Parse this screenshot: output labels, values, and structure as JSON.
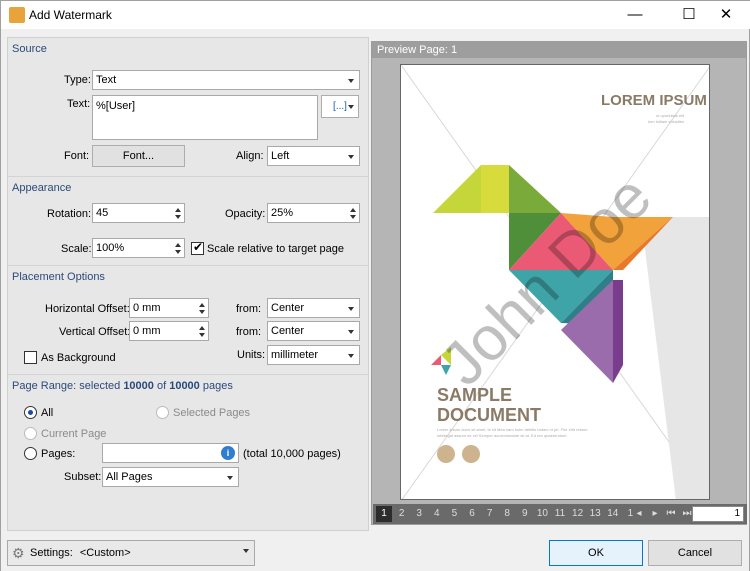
{
  "window": {
    "title": "Add Watermark",
    "minimize": "—",
    "maximize": "☐",
    "close": "✕"
  },
  "source": {
    "heading": "Source",
    "type_label": "Type:",
    "type_value": "Text",
    "text_label": "Text:",
    "text_value": "%[User]",
    "macro_button": "[...]",
    "font_label": "Font:",
    "font_button": "Font...",
    "align_label": "Align:",
    "align_value": "Left"
  },
  "appearance": {
    "heading": "Appearance",
    "rotation_label": "Rotation:",
    "rotation_value": "45",
    "opacity_label": "Opacity:",
    "opacity_value": "25%",
    "scale_label": "Scale:",
    "scale_value": "100%",
    "scale_relative_label": "Scale relative to target page",
    "scale_relative_checked": true
  },
  "placement": {
    "heading": "Placement Options",
    "h_offset_label": "Horizontal Offset:",
    "h_offset_value": "0 mm",
    "h_from_label": "from:",
    "h_from_value": "Center",
    "v_offset_label": "Vertical Offset:",
    "v_offset_value": "0 mm",
    "v_from_label": "from:",
    "v_from_value": "Center",
    "background_label": "As Background",
    "background_checked": false,
    "units_label": "Units:",
    "units_value": "millimeter"
  },
  "page_range": {
    "heading_prefix": "Page Range: selected ",
    "selected": "10000",
    "heading_mid": " of ",
    "total": "10000",
    "heading_suffix": " pages",
    "all_label": "All",
    "selected_pages_label": "Selected Pages",
    "current_page_label": "Current Page",
    "pages_label": "Pages:",
    "pages_value": "",
    "total_note": "(total 10,000 pages)",
    "subset_label": "Subset:",
    "subset_value": "All Pages"
  },
  "preview": {
    "header": "Preview Page: 1",
    "page_input": "1",
    "pages": [
      "1",
      "2",
      "3",
      "4",
      "5",
      "6",
      "7",
      "8",
      "9",
      "10",
      "11",
      "12",
      "13",
      "14",
      "1"
    ],
    "doc": {
      "lorem": "LOREM IPSUM",
      "lorem_sub1": "ut oporluitas elit",
      "lorem_sub2": "lorn tolliam volusites",
      "sample1": "SAMPLE",
      "sample2": "DOCUMENT",
      "body1": "Lorem ipsum dolor sit amet, te sit Mea nam bolm debitis habeo nt pri. Fier elitr rebum",
      "body2": "intellegat assum ne vel Semper accommodare sit at. Ed ren quaerendum",
      "watermark": "John Doe"
    }
  },
  "bottom": {
    "settings_label": "Settings:",
    "settings_value": "<Custom>",
    "ok": "OK",
    "cancel": "Cancel"
  }
}
